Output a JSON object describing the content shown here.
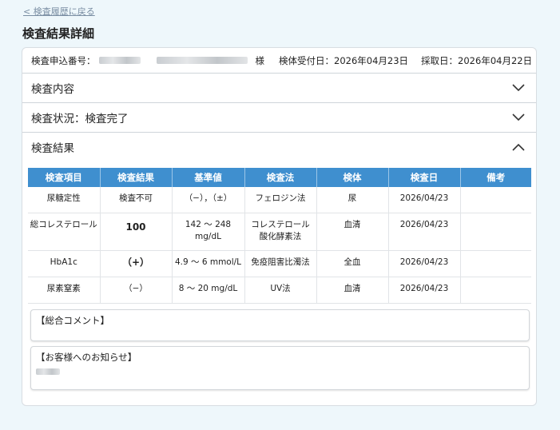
{
  "nav": {
    "back_label": "< 検査履歴に戻る"
  },
  "page": {
    "title": "検査結果詳細"
  },
  "info": {
    "application_label": "検査申込番号：",
    "honorific": "様",
    "reception_label": "検体受付日：",
    "reception_date": "2026年04月23日",
    "collection_label": "採取日：",
    "collection_date": "2026年04月22日"
  },
  "sections": {
    "contents": "検査内容",
    "status": "検査状況：検査完了",
    "results": "検査結果"
  },
  "table": {
    "headers": [
      "検査項目",
      "検査結果",
      "基準値",
      "検査法",
      "検体",
      "検査日",
      "備考"
    ],
    "rows": [
      {
        "item": "尿糖定性",
        "result": "検査不可",
        "reference": "（−），（±）",
        "method": "フェロジン法",
        "specimen": "尿",
        "date": "2026/04/23",
        "note": ""
      },
      {
        "item": "総コレステロール",
        "result": "100",
        "reference": "142 〜 248 mg/dL",
        "method": "コレステロール酸化酵素法",
        "specimen": "血清",
        "date": "2026/04/23",
        "note": ""
      },
      {
        "item": "HbA1c",
        "result": "（+）",
        "reference": "4.9 〜 6 mmol/L",
        "method": "免疫阻害比濁法",
        "specimen": "全血",
        "date": "2026/04/23",
        "note": ""
      },
      {
        "item": "尿素窒素",
        "result": "（−）",
        "reference": "8 〜 20 mg/dL",
        "method": "UV法",
        "specimen": "血清",
        "date": "2026/04/23",
        "note": ""
      }
    ]
  },
  "comments": {
    "overall_label": "【総合コメント】",
    "notice_label": "【お客様へのお知らせ】"
  },
  "colors": {
    "header_blue": "#3f8fcf",
    "result_blue": "#1e3fa8",
    "result_red": "#c0262d",
    "background": "#eef7fb"
  }
}
